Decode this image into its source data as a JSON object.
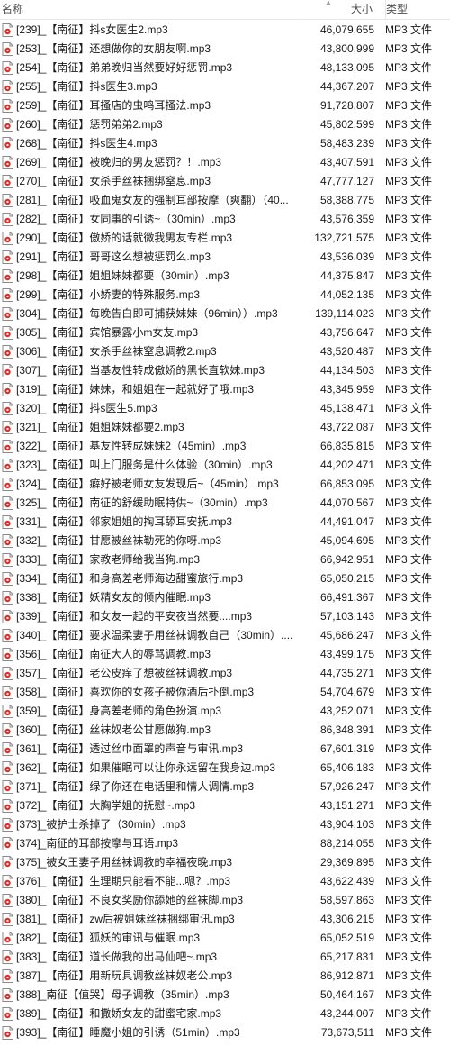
{
  "columns": {
    "name": "名称",
    "size": "大小",
    "type": "类型"
  },
  "sort_indicator": "▲",
  "files": [
    {
      "name": "[239]_【南征】抖s女医生2.mp3",
      "size": "46,079,655",
      "type": "MP3 文件"
    },
    {
      "name": "[253]_【南征】还想做你的女朋友啊.mp3",
      "size": "43,800,999",
      "type": "MP3 文件"
    },
    {
      "name": "[254]_【南征】弟弟晚归当然要好好惩罚.mp3",
      "size": "48,133,095",
      "type": "MP3 文件"
    },
    {
      "name": "[255]_【南征】抖s医生3.mp3",
      "size": "44,367,207",
      "type": "MP3 文件"
    },
    {
      "name": "[259]_【南征】耳搔店的虫鸣耳搔法.mp3",
      "size": "91,728,807",
      "type": "MP3 文件"
    },
    {
      "name": "[260]_【南征】惩罚弟弟2.mp3",
      "size": "45,802,599",
      "type": "MP3 文件"
    },
    {
      "name": "[268]_【南征】抖s医生4.mp3",
      "size": "58,483,239",
      "type": "MP3 文件"
    },
    {
      "name": "[269]_【南征】被晚归的男友惩罚？！.mp3",
      "size": "43,407,591",
      "type": "MP3 文件"
    },
    {
      "name": "[270]_【南征】女杀手丝袜捆绑窒息.mp3",
      "size": "47,777,127",
      "type": "MP3 文件"
    },
    {
      "name": "[281]_【南征】吸血鬼女友的强制耳部按摩（爽翻）（40...",
      "size": "58,388,775",
      "type": "MP3 文件"
    },
    {
      "name": "[282]_【南征】女同事的引诱~（30min）.mp3",
      "size": "43,576,359",
      "type": "MP3 文件"
    },
    {
      "name": "[290]_【南征】傲娇的话就微我男友专栏.mp3",
      "size": "132,721,575",
      "type": "MP3 文件"
    },
    {
      "name": "[291]_【南征】哥哥这么想被惩罚么.mp3",
      "size": "43,536,039",
      "type": "MP3 文件"
    },
    {
      "name": "[298]_【南征】姐姐妹妹都要（30min）.mp3",
      "size": "44,375,847",
      "type": "MP3 文件"
    },
    {
      "name": "[299]_【南征】小娇妻的特殊服务.mp3",
      "size": "44,052,135",
      "type": "MP3 文件"
    },
    {
      "name": "[304]_【南征】每晚告白即可捕获妹妹（96min））.mp3",
      "size": "139,114,023",
      "type": "MP3 文件"
    },
    {
      "name": "[305]_【南征】宾馆暴露小m女友.mp3",
      "size": "43,756,647",
      "type": "MP3 文件"
    },
    {
      "name": "[306]_【南征】女杀手丝袜窒息调教2.mp3",
      "size": "43,520,487",
      "type": "MP3 文件"
    },
    {
      "name": "[307]_【南征】当基友性转成傲娇的黑长直软妹.mp3",
      "size": "44,134,503",
      "type": "MP3 文件"
    },
    {
      "name": "[319]_【南征】妹妹，和姐姐在一起就好了哦.mp3",
      "size": "43,345,959",
      "type": "MP3 文件"
    },
    {
      "name": "[320]_【南征】抖s医生5.mp3",
      "size": "45,138,471",
      "type": "MP3 文件"
    },
    {
      "name": "[321]_【南征】姐姐妹妹都要2.mp3",
      "size": "43,722,087",
      "type": "MP3 文件"
    },
    {
      "name": "[322]_【南征】基友性转成妹妹2（45min）.mp3",
      "size": "66,835,815",
      "type": "MP3 文件"
    },
    {
      "name": "[323]_【南征】叫上门服务是什么体验（30min）.mp3",
      "size": "44,202,471",
      "type": "MP3 文件"
    },
    {
      "name": "[324]_【南征】癖好被老师女友发现后~（45min）.mp3",
      "size": "66,853,095",
      "type": "MP3 文件"
    },
    {
      "name": "[325]_【南征】南征的舒缓助眠特供~（30min）.mp3",
      "size": "44,070,567",
      "type": "MP3 文件"
    },
    {
      "name": "[331]_【南征】邻家姐姐的掏耳舔耳安抚.mp3",
      "size": "44,491,047",
      "type": "MP3 文件"
    },
    {
      "name": "[332]_【南征】甘愿被丝袜勒死的你呀.mp3",
      "size": "45,094,695",
      "type": "MP3 文件"
    },
    {
      "name": "[333]_【南征】家教老师给我当狗.mp3",
      "size": "66,942,951",
      "type": "MP3 文件"
    },
    {
      "name": "[334]_【南征】和身高差老师海边甜蜜旅行.mp3",
      "size": "65,050,215",
      "type": "MP3 文件"
    },
    {
      "name": "[338]_【南征】妖精女友的倾内催眠.mp3",
      "size": "66,491,367",
      "type": "MP3 文件"
    },
    {
      "name": "[339]_【南征】和女友一起的平安夜当然要....mp3",
      "size": "57,103,143",
      "type": "MP3 文件"
    },
    {
      "name": "[340]_【南征】要求温柔妻子用丝袜调教自己（30min）....",
      "size": "45,686,247",
      "type": "MP3 文件"
    },
    {
      "name": "[356]_【南征】南征大人的辱骂调教.mp3",
      "size": "43,499,175",
      "type": "MP3 文件"
    },
    {
      "name": "[357]_【南征】老公皮痒了想被丝袜调教.mp3",
      "size": "44,735,271",
      "type": "MP3 文件"
    },
    {
      "name": "[358]_【南征】喜欢你的女孩子被你酒后扑倒.mp3",
      "size": "54,704,679",
      "type": "MP3 文件"
    },
    {
      "name": "[359]_【南征】身高差老师的角色扮演.mp3",
      "size": "43,252,071",
      "type": "MP3 文件"
    },
    {
      "name": "[360]_【南征】丝袜奴老公甘愿做狗.mp3",
      "size": "86,348,391",
      "type": "MP3 文件"
    },
    {
      "name": "[361]_【南征】透过丝巾面罩的声音与审讯.mp3",
      "size": "67,601,319",
      "type": "MP3 文件"
    },
    {
      "name": "[362]_【南征】如果催眠可以让你永远留在我身边.mp3",
      "size": "65,406,183",
      "type": "MP3 文件"
    },
    {
      "name": "[371]_【南征】绿了你还在电话里和情人调情.mp3",
      "size": "57,926,247",
      "type": "MP3 文件"
    },
    {
      "name": "[372]_【南征】大胸学姐的抚慰~.mp3",
      "size": "43,151,271",
      "type": "MP3 文件"
    },
    {
      "name": "[373]_被护士杀掉了（30min）.mp3",
      "size": "43,904,103",
      "type": "MP3 文件"
    },
    {
      "name": "[374]_南征的耳部按摩与耳语.mp3",
      "size": "88,214,055",
      "type": "MP3 文件"
    },
    {
      "name": "[375]_被女王妻子用丝袜调教的幸福夜晚.mp3",
      "size": "29,369,895",
      "type": "MP3 文件"
    },
    {
      "name": "[376]_【南征】生理期只能看不能...嗯？.mp3",
      "size": "43,622,439",
      "type": "MP3 文件"
    },
    {
      "name": "[380]_【南征】不良女奖励你舔她的丝袜脚.mp3",
      "size": "58,597,863",
      "type": "MP3 文件"
    },
    {
      "name": "[381]_【南征】zw后被姐妹丝袜捆绑审讯.mp3",
      "size": "43,306,215",
      "type": "MP3 文件"
    },
    {
      "name": "[382]_【南征】狐妖的审讯与催眠.mp3",
      "size": "65,052,519",
      "type": "MP3 文件"
    },
    {
      "name": "[383]_【南征】道长做我的出马仙吧~.mp3",
      "size": "65,217,831",
      "type": "MP3 文件"
    },
    {
      "name": "[387]_【南征】用新玩具调教丝袜奴老公.mp3",
      "size": "86,912,871",
      "type": "MP3 文件"
    },
    {
      "name": "[388]_南征【值哭】母子调教（35min）.mp3",
      "size": "50,464,167",
      "type": "MP3 文件"
    },
    {
      "name": "[389]_【南征】和撒娇女友的甜蜜宅家.mp3",
      "size": "43,244,007",
      "type": "MP3 文件"
    },
    {
      "name": "[393]_【南征】睡魔小姐的引诱（51min）.mp3",
      "size": "73,673,511",
      "type": "MP3 文件"
    }
  ]
}
